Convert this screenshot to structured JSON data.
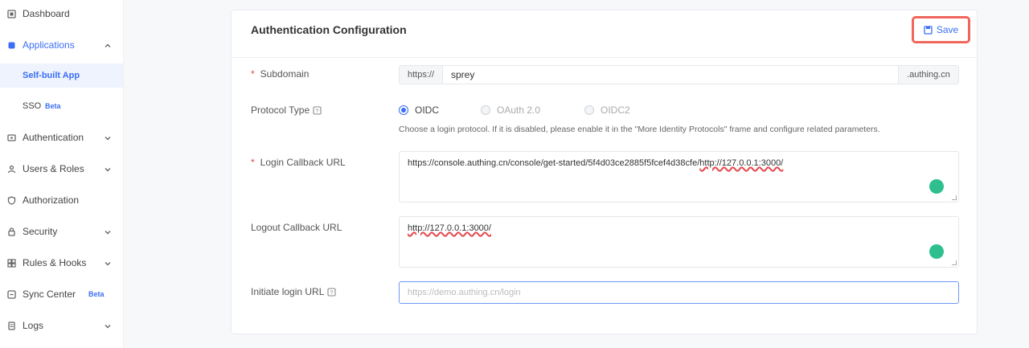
{
  "sidebar": {
    "items": [
      {
        "label": "Dashboard",
        "icon": "dashboard-icon"
      },
      {
        "label": "Applications",
        "icon": "applications-icon",
        "expanded": true
      },
      {
        "label": "Self-built App"
      },
      {
        "label": "SSO",
        "badge": "Beta"
      },
      {
        "label": "Authentication",
        "icon": "authentication-icon"
      },
      {
        "label": "Users & Roles",
        "icon": "users-icon"
      },
      {
        "label": "Authorization",
        "icon": "authorization-icon"
      },
      {
        "label": "Security",
        "icon": "security-icon"
      },
      {
        "label": "Rules & Hooks",
        "icon": "rules-icon"
      },
      {
        "label": "Sync Center",
        "icon": "sync-icon",
        "badge": "Beta"
      },
      {
        "label": "Logs",
        "icon": "logs-icon"
      }
    ]
  },
  "card": {
    "title": "Authentication Configuration",
    "save_label": "Save"
  },
  "form": {
    "domain": {
      "label": "Subdomain",
      "prefix": "https://",
      "value": "sprey",
      "suffix": ".authing.cn"
    },
    "protocol": {
      "label": "Protocol Type",
      "options": [
        "OIDC",
        "OAuth 2.0",
        "OIDC2"
      ],
      "selected": "OIDC",
      "hint": "Choose a login protocol. If it is disabled, please enable it in the \"More Identity Protocols\" frame and configure related parameters."
    },
    "login_callback": {
      "label": "Login Callback URL",
      "value_plain": "https://console.authing.cn/console/get-started/5f4d03ce2885f5fcef4d38cfe/",
      "value_marked": "http://127.0.0.1:3000/"
    },
    "logout_callback": {
      "label": "Logout Callback URL",
      "value_marked": "http://127.0.0.1:3000/"
    },
    "initiate_login": {
      "label": "Initiate login URL",
      "placeholder": "https://demo.authing.cn/login"
    }
  },
  "colors": {
    "accent": "#3b6ef5",
    "highlight": "#f0665c",
    "grammar": "#2fbf8f"
  }
}
